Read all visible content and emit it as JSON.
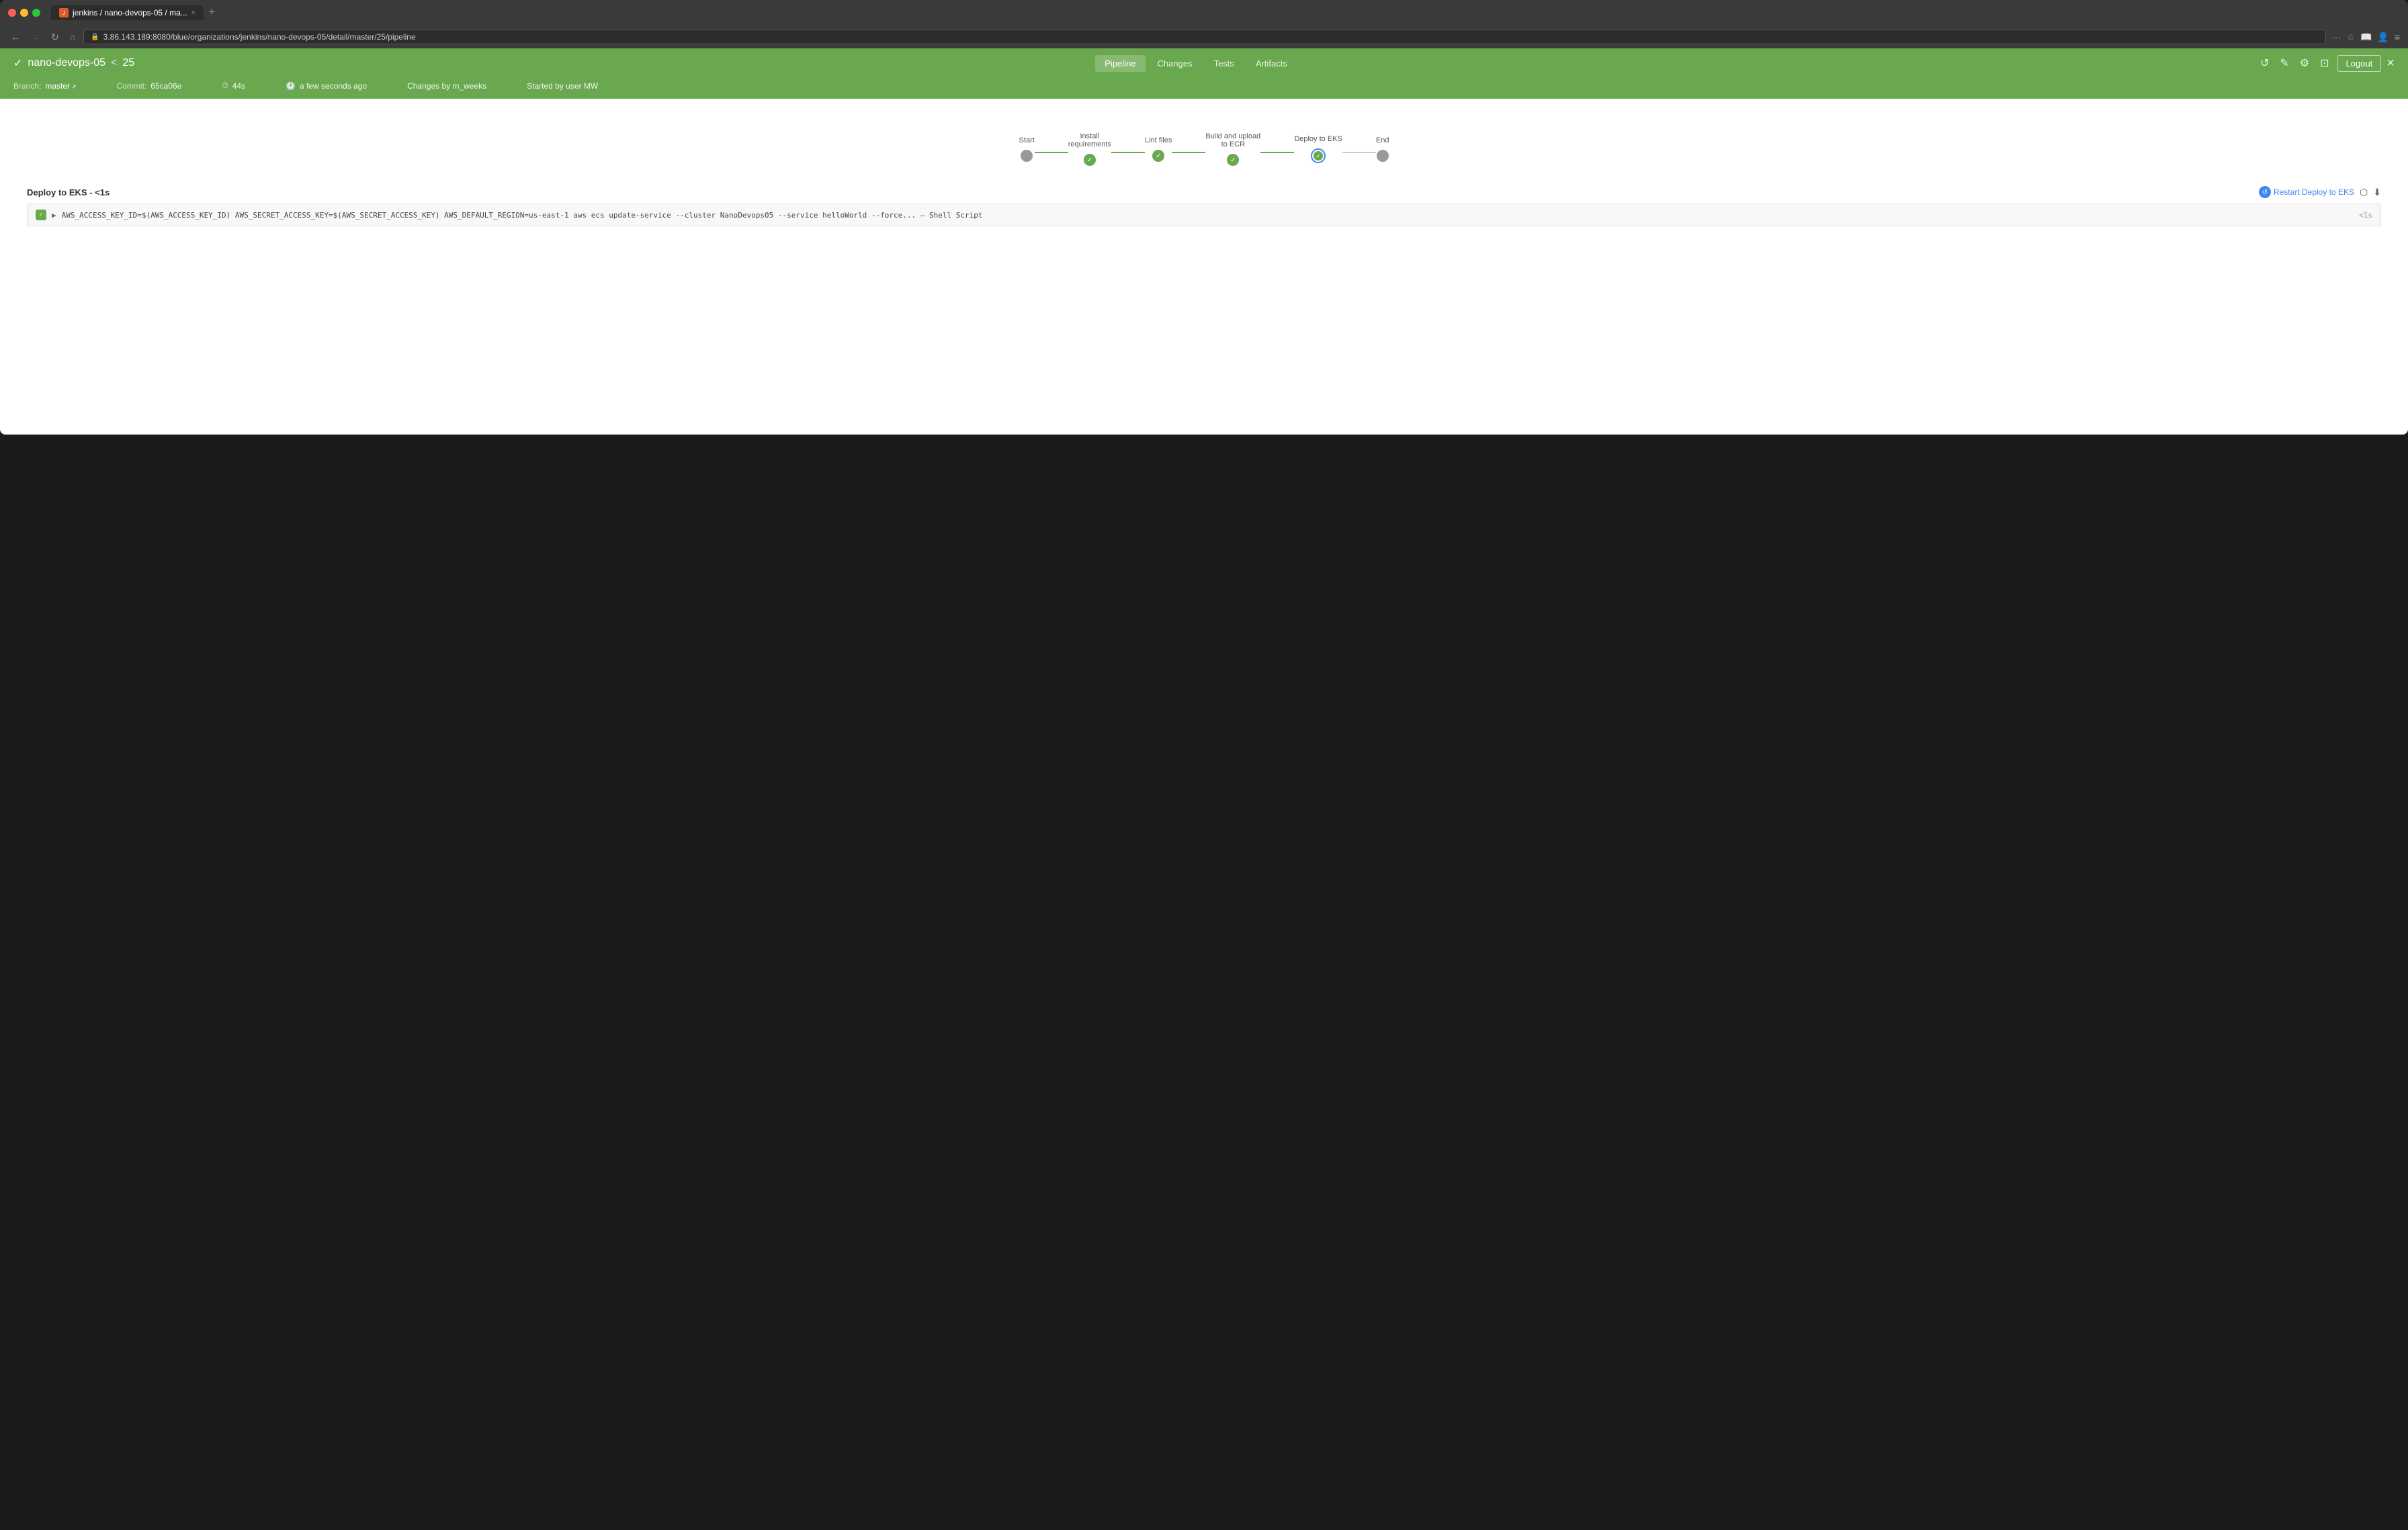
{
  "browser": {
    "tab_favicon": "J",
    "tab_label": "jenkins / nano-devops-05 / ma...",
    "tab_close": "×",
    "new_tab": "+",
    "address": "3.86.143.189:8080/blue/organizations/jenkins/nano-devops-05/detail/master/25/pipeline",
    "back_disabled": false,
    "forward_disabled": true
  },
  "header": {
    "check_symbol": "✓",
    "project_name": "nano-devops-05",
    "separator": "<",
    "build_number": "25",
    "nav_tabs": [
      "Pipeline",
      "Changes",
      "Tests",
      "Artifacts"
    ],
    "active_tab": "Pipeline",
    "icons": {
      "reload": "↺",
      "edit": "✎",
      "settings": "⚙",
      "exit": "⊞"
    },
    "logout_label": "Logout",
    "close_symbol": "×"
  },
  "meta": {
    "branch_label": "Branch:",
    "branch_value": "master",
    "commit_label": "Commit:",
    "commit_value": "65ca06e",
    "duration_value": "44s",
    "time_value": "a few seconds ago",
    "changes_by": "Changes by m_weeks",
    "started_by": "Started by user MW"
  },
  "pipeline": {
    "stages": [
      {
        "label": "Start",
        "status": "grey",
        "line_after": false
      },
      {
        "label": "Install\nrequirements",
        "status": "green",
        "line_after": true
      },
      {
        "label": "Lint files",
        "status": "green",
        "line_after": true
      },
      {
        "label": "Build and upload\nto ECR",
        "status": "green",
        "line_after": true
      },
      {
        "label": "Deploy to EKS",
        "status": "active",
        "line_after": true
      },
      {
        "label": "End",
        "status": "grey",
        "line_after": false
      }
    ]
  },
  "deploy_section": {
    "title": "Deploy to EKS - <1s",
    "restart_label": "Restart Deploy to EKS",
    "log": {
      "command": "AWS_ACCESS_KEY_ID=$(AWS_ACCESS_KEY_ID) AWS_SECRET_ACCESS_KEY=$(AWS_SECRET_ACCESS_KEY) AWS_DEFAULT_REGION=us-east-1 aws ecs update-service --cluster NanoDevops05 --service helloWorld --force... — Shell Script",
      "type": "Shell Script",
      "time": "<1s"
    }
  }
}
